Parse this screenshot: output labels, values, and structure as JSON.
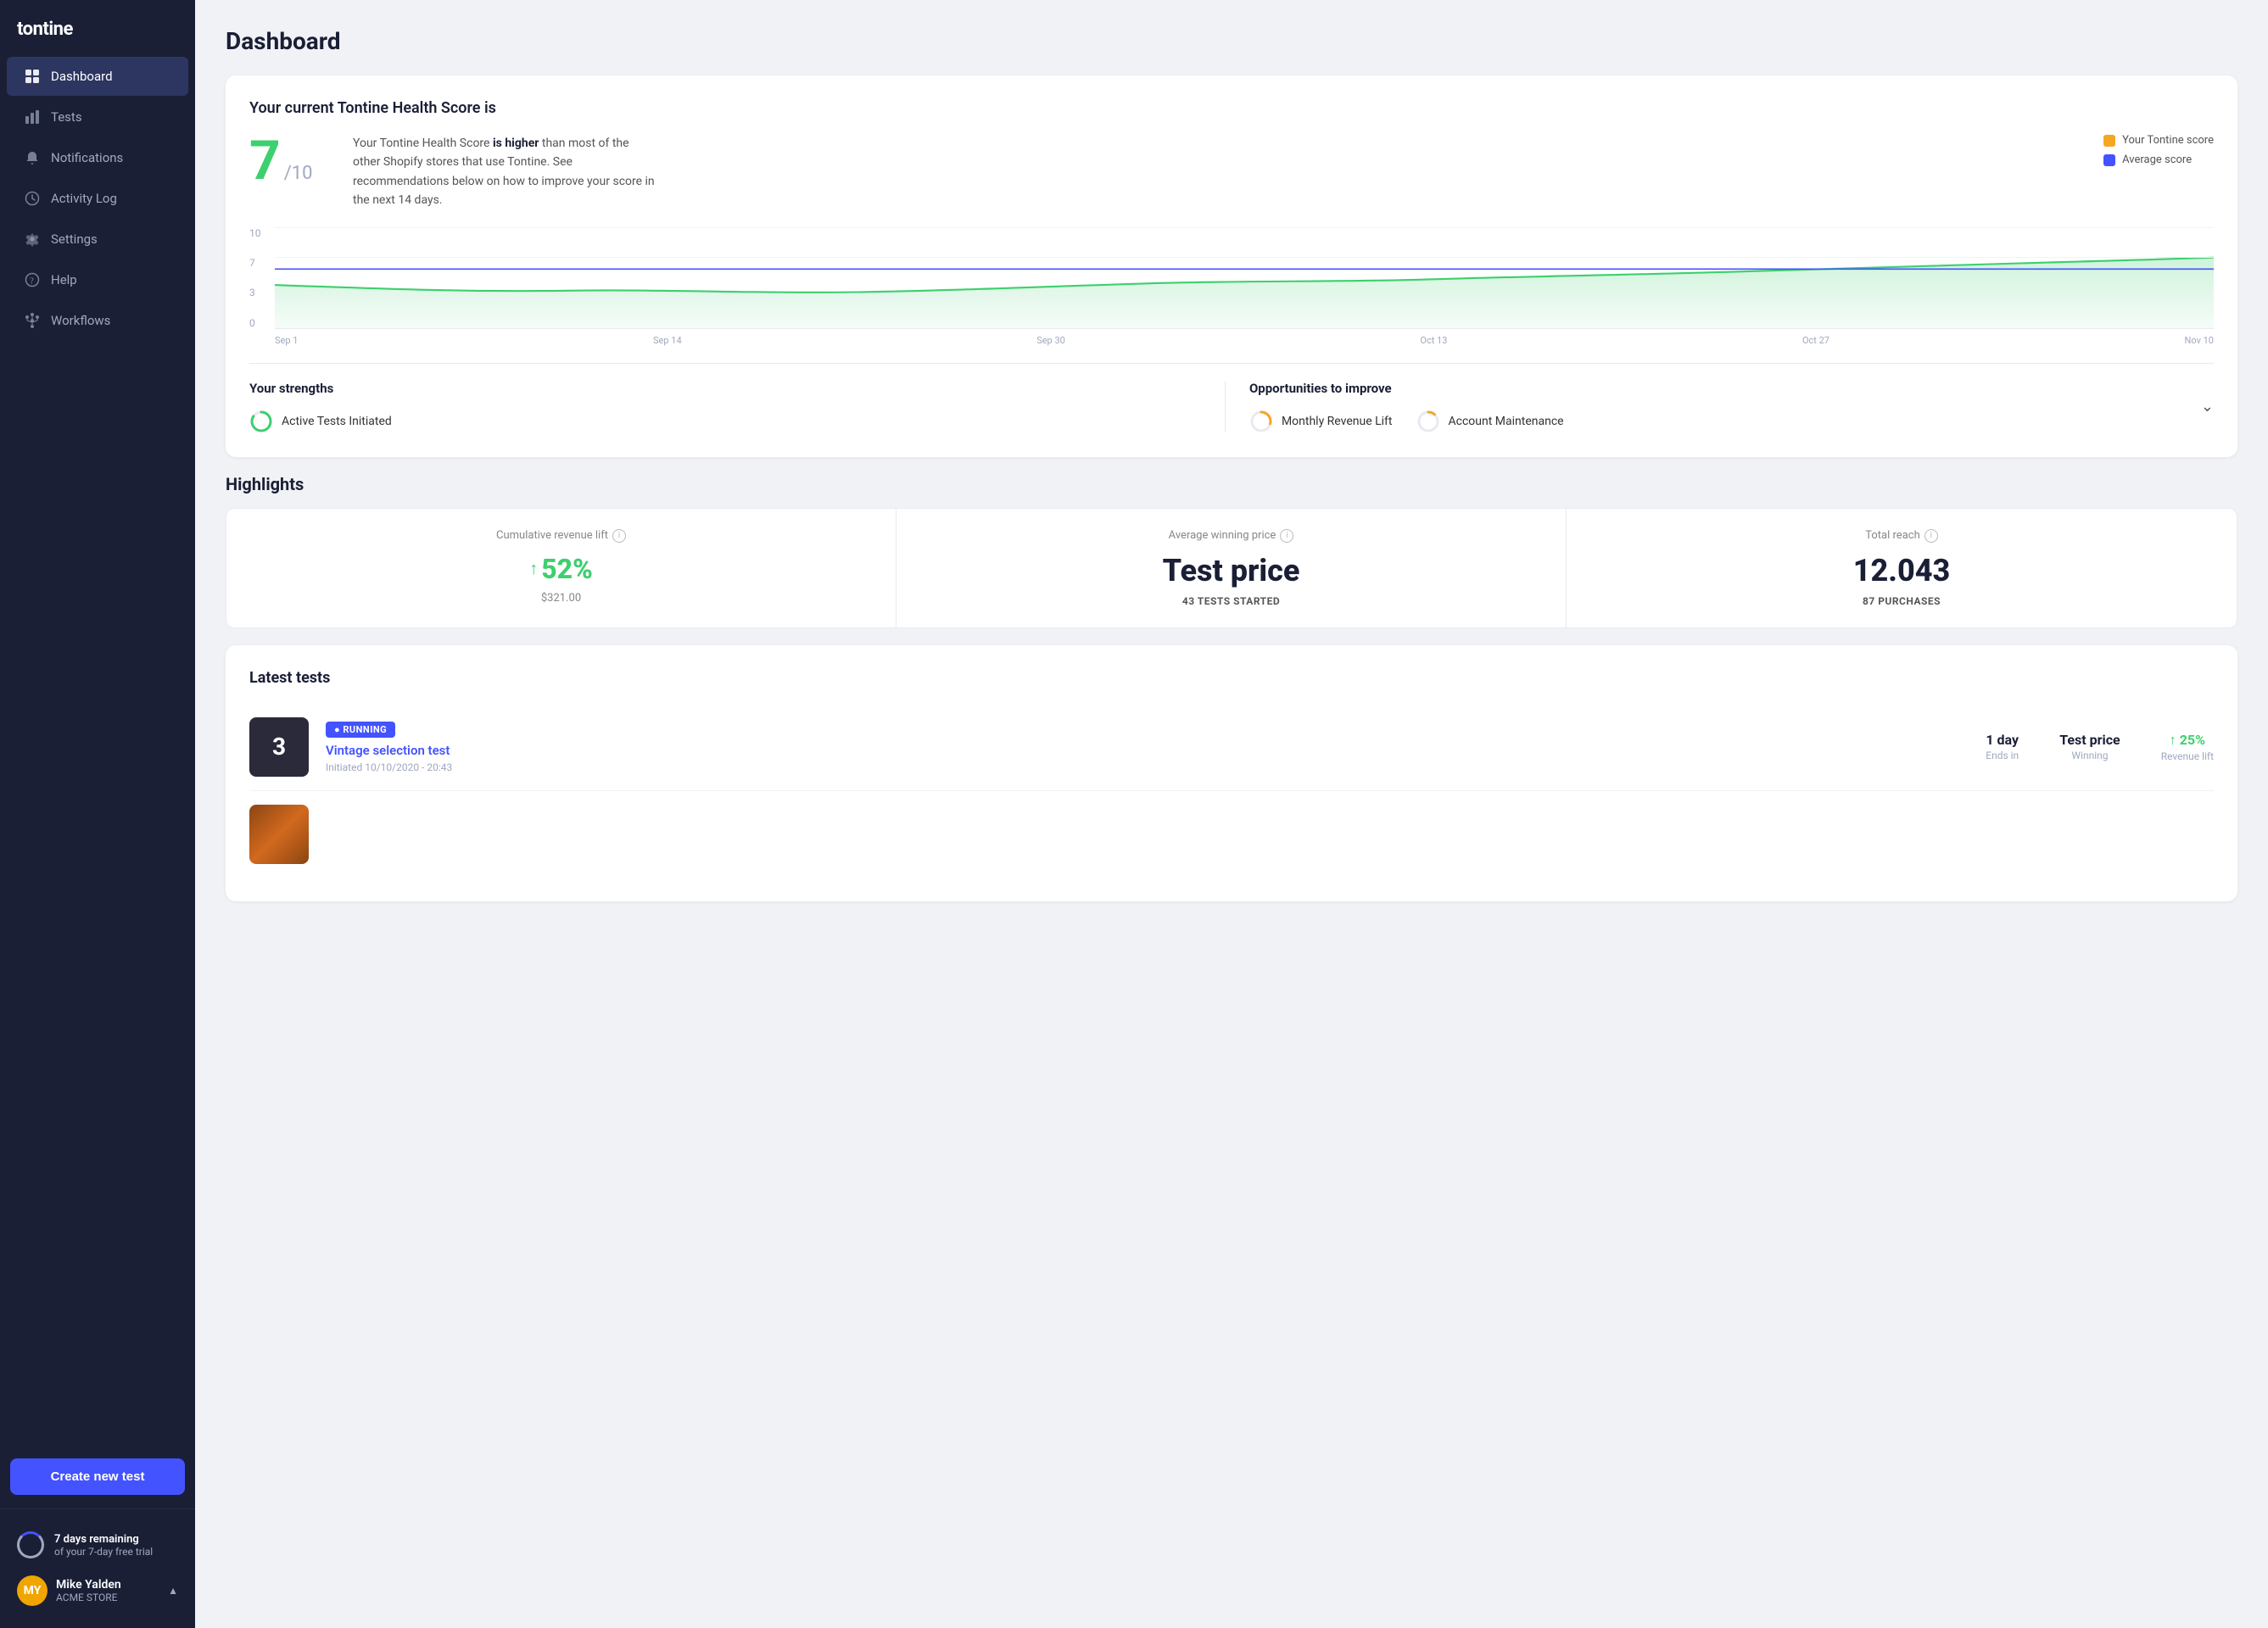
{
  "app": {
    "name": "tontine",
    "logo_text": "tontine"
  },
  "sidebar": {
    "items": [
      {
        "id": "dashboard",
        "label": "Dashboard",
        "icon": "grid-icon",
        "active": true
      },
      {
        "id": "tests",
        "label": "Tests",
        "icon": "bar-chart-icon",
        "active": false
      },
      {
        "id": "notifications",
        "label": "Notifications",
        "icon": "bell-icon",
        "active": false
      },
      {
        "id": "activity-log",
        "label": "Activity Log",
        "icon": "clock-icon",
        "active": false
      },
      {
        "id": "settings",
        "label": "Settings",
        "icon": "gear-icon",
        "active": false
      },
      {
        "id": "help",
        "label": "Help",
        "icon": "help-icon",
        "active": false
      },
      {
        "id": "workflows",
        "label": "Workflows",
        "icon": "workflow-icon",
        "active": false
      }
    ],
    "create_button_label": "Create new test"
  },
  "trial": {
    "days_remaining": "7 days remaining",
    "sub_text": "of your 7-day free trial"
  },
  "user": {
    "initials": "MY",
    "name": "Mike Yalden",
    "store": "ACME STORE"
  },
  "page": {
    "title": "Dashboard"
  },
  "health_score": {
    "title": "Your current Tontine Health Score is",
    "score": "7",
    "denom": "/10",
    "description_pre": "Your Tontine Health Score ",
    "description_bold": "is higher",
    "description_post": " than most of the other Shopify stores that use Tontine. See recommendations below on how to improve your score in the next 14 days.",
    "legend": [
      {
        "label": "Your Tontine score",
        "color": "#f5a623"
      },
      {
        "label": "Average score",
        "color": "#4353ff"
      }
    ],
    "chart": {
      "y_labels": [
        "10",
        "7",
        "3",
        "0"
      ],
      "x_labels": [
        "Sep 1",
        "Sep 14",
        "Sep 30",
        "Oct 13",
        "Oct 27",
        "Nov 10"
      ],
      "gridlines": [
        0,
        30,
        70,
        100
      ]
    }
  },
  "strengths": {
    "title": "Your strengths",
    "items": [
      {
        "label": "Active Tests Initiated",
        "progress": 85,
        "color": "#3ecf6e"
      }
    ],
    "opportunities_title": "Opportunities to improve",
    "opportunities": [
      {
        "label": "Monthly Revenue Lift",
        "progress": 30,
        "color": "#f5a623"
      },
      {
        "label": "Account Maintenance",
        "progress": 15,
        "color": "#e8eaf0"
      }
    ]
  },
  "highlights": {
    "title": "Highlights",
    "cells": [
      {
        "label": "Cumulative revenue lift",
        "value": "52%",
        "value_type": "green_arrow",
        "sub": "$321.00",
        "sub_type": "normal"
      },
      {
        "label": "Average winning price",
        "value": "Test price",
        "value_type": "large",
        "sub": "43 TESTS STARTED",
        "sub_type": "bold"
      },
      {
        "label": "Total reach",
        "value": "12.043",
        "value_type": "large",
        "sub": "87 PURCHASES",
        "sub_type": "bold"
      }
    ]
  },
  "latest_tests": {
    "title": "Latest tests",
    "items": [
      {
        "id": "vintage-selection-test",
        "badge": "● RUNNING",
        "name": "Vintage selection test",
        "date": "Initiated 10/10/2020 - 20:43",
        "thumb_text": "3",
        "metrics": [
          {
            "value": "1 day",
            "label": "Ends in"
          },
          {
            "value": "Test price",
            "label": "Winning"
          },
          {
            "value": "↑ 25%",
            "label": "Revenue lift",
            "green": true
          }
        ]
      },
      {
        "id": "test-2",
        "badge": "",
        "name": "",
        "date": "",
        "thumb_text": "",
        "metrics": []
      }
    ]
  }
}
